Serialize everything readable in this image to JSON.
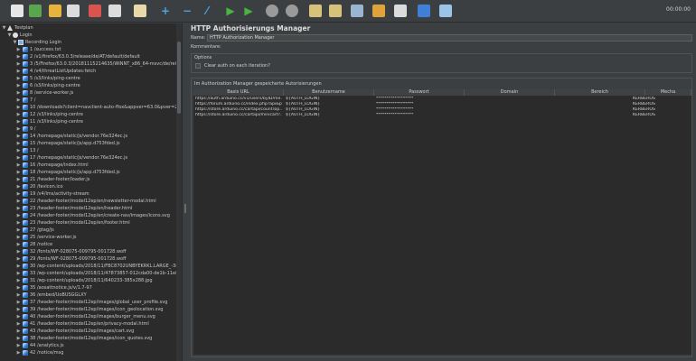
{
  "toolbar": {
    "timer": "00:00:00",
    "buttons": [
      {
        "name": "new-plan-icon",
        "color": "#e6e6e6"
      },
      {
        "name": "templates-icon",
        "color": "#5aa64f"
      },
      {
        "name": "open-icon",
        "color": "#e6b43c"
      },
      {
        "name": "save-icon",
        "color": "#dcdcdc"
      },
      {
        "name": "cut-icon",
        "color": "#d9534f"
      },
      {
        "name": "copy-icon",
        "color": "#dcdcdc"
      },
      {
        "name": "paste-icon",
        "color": "#e8d9a8"
      },
      {
        "name": "expand-icon",
        "color": "#4ea3e0",
        "glyph": "+"
      },
      {
        "name": "collapse-icon",
        "color": "#4ea3e0",
        "glyph": "−"
      },
      {
        "name": "toggle-icon",
        "color": "#4ea3e0",
        "glyph": "⁄"
      },
      {
        "name": "start-icon",
        "color": "#46b63c",
        "glyph": "▶"
      },
      {
        "name": "start-no-pause-icon",
        "color": "#46b63c",
        "glyph": "▶"
      },
      {
        "name": "stop-icon",
        "color": "#9a9a9a"
      },
      {
        "name": "shutdown-icon",
        "color": "#9a9a9a"
      },
      {
        "name": "clear-icon",
        "color": "#d6c27a"
      },
      {
        "name": "clear-all-icon",
        "color": "#d6c27a"
      },
      {
        "name": "search-icon",
        "color": "#9bb5d0"
      },
      {
        "name": "reset-search-icon",
        "color": "#e0a23a"
      },
      {
        "name": "function-helper-icon",
        "color": "#dcdcdc"
      },
      {
        "name": "help-icon",
        "color": "#3f7fd8"
      },
      {
        "name": "remote-icon",
        "color": "#9ac4e8"
      }
    ]
  },
  "tree": {
    "root": "Testplan",
    "thread_group": "Login",
    "recorder": "Recording Login",
    "items": [
      "1 /success.txt",
      "2 /v1/firefox/63.0.3/release/de/AT/default/default",
      "3 /5/Firefox/63.0.3/20181115214635/WINNT_x86_64-msvc/de/releas-",
      "4 /v4/threatListUpdates:fetch",
      "5 /s3/links/ping-centre",
      "6 /s3/links/ping-centre",
      "8 /service-worker.js",
      "7 /",
      "10 /downloads?client=navclient-auto-ffox&appver=63.0&pver=2.2",
      "12 /s3/links/ping-centre",
      "11 /s3/links/ping-centre",
      "9 /",
      "14 /homepage/static/js/vendor.76e324ec.js",
      "15 /homepage/static/js/app.d753fded.js",
      "13 /",
      "17 /homepage/static/js/vendor.76e324ec.js",
      "16 /homepage/index.html",
      "18 /homepage/static/js/app.d753fded.js",
      "21 /header-footer/loader.js",
      "20 /favicon.ico",
      "19 /v4/lms/activity-stream",
      "22 /header-footer/model12ep/en/newsletter-modal.html",
      "23 /header-footer/model12ep/en/header.html",
      "24 /header-footer/model12ep/en/create-nav/images/icons.svg",
      "23 /header-footer/model12ep/en/footer.html",
      "27 /gtag/js",
      "25 /service-worker.js",
      "28 /notice",
      "32 /fonts/WF-028075-009795-001728.woff",
      "29 /fonts/WF-028075-009795-001728.woff",
      "30 /wp-content/uploads/2018/11/FBC8702UNBYEKRKL.LARGE_-385x",
      "33 /wp-content/uploads/2018/11/47873857-012cda00-de1b-11e8-95",
      "31 /wp-content/uploads/2018/11/640233-385x288.jpg",
      "35 /aosattnotice.js/v/1.7-97",
      "36 /embed/UoBUSGGLXY",
      "37 /header-footer/model12ep/images/global_user_profile.svg",
      "39 /header-footer/model12ep/images/icon_geolocation.svg",
      "40 /header-footer/model12ep/images/burger_menu.svg",
      "41 /header-footer/model12ep/en/privacy-modal.html",
      "43 /header-footer/model12ep/images/cart.svg",
      "38 /header-footer/model12ep/images/icon_quotes.svg",
      "44 /analytics.js",
      "42 /notice/msg"
    ]
  },
  "panel": {
    "title": "HTTP Authorisierungs Manager",
    "name_label": "Name:",
    "name_value": "HTTP Authorization Manager",
    "comments_label": "Kommentare:",
    "options_title": "Options",
    "clear_label": "Clear auth on each iteration?",
    "stored_title": "Im Authorization Manager gespeicherte Autorisierungen",
    "columns": [
      "Basis URL",
      "Benutzername",
      "Passwort",
      "Domain",
      "Bereich",
      "Mecha"
    ],
    "rows": [
      {
        "url": "https://auth.arduino.cc/v1/users/byID/me...",
        "user": "${AUTH_LOGIN}",
        "pass": "******************",
        "domain": "",
        "realm": "",
        "mech": "KERBEROS"
      },
      {
        "url": "https://forum.arduino.cc/index.php?api&p...",
        "user": "${AUTH_LOGIN}",
        "pass": "******************",
        "domain": "",
        "realm": "",
        "mech": "KERBEROS"
      },
      {
        "url": "https://store.arduino.cc/cartapi/countTop...",
        "user": "${AUTH_LOGIN}",
        "pass": "******************",
        "domain": "",
        "realm": "",
        "mech": "KERBEROS"
      },
      {
        "url": "https://store.arduino.cc/cartapi/minicart?...",
        "user": "${AUTH_LOGIN}",
        "pass": "******************",
        "domain": "",
        "realm": "",
        "mech": "KERBEROS"
      }
    ]
  }
}
